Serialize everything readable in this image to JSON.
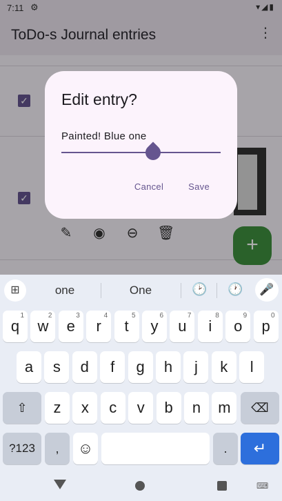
{
  "status_bar": {
    "time": "7:11",
    "gear_icon": "⚙",
    "system_icons": "▾◢▮"
  },
  "app_bar": {
    "title": "ToDo-s Journal entries",
    "menu_icon": "⋮"
  },
  "list": {
    "row1_checked": "✓",
    "row2_checked": "✓",
    "actions": [
      "✎",
      "◉",
      "⊖",
      "🗑"
    ],
    "fab_icon": "+"
  },
  "dialog": {
    "title": "Edit entry?",
    "field_value": "Painted! Blue one",
    "cancel_label": "Cancel",
    "save_label": "Save"
  },
  "keyboard": {
    "suggestions": [
      "one",
      "One"
    ],
    "grid_icon": "⊞",
    "mic_icon": "🎤",
    "emoji1": "🕑",
    "emoji2": "🕐",
    "row1": [
      {
        "k": "q",
        "h": "1"
      },
      {
        "k": "w",
        "h": "2"
      },
      {
        "k": "e",
        "h": "3"
      },
      {
        "k": "r",
        "h": "4"
      },
      {
        "k": "t",
        "h": "5"
      },
      {
        "k": "y",
        "h": "6"
      },
      {
        "k": "u",
        "h": "7"
      },
      {
        "k": "i",
        "h": "8"
      },
      {
        "k": "o",
        "h": "9"
      },
      {
        "k": "p",
        "h": "0"
      }
    ],
    "row2": [
      "a",
      "s",
      "d",
      "f",
      "g",
      "h",
      "j",
      "k",
      "l"
    ],
    "row3": [
      "z",
      "x",
      "c",
      "v",
      "b",
      "n",
      "m"
    ],
    "shift_icon": "⇧",
    "backspace_icon": "⌫",
    "sym_label": "?123",
    "comma": ",",
    "emoji_key": "☺",
    "period": ".",
    "enter_icon": "↵"
  },
  "nav": {
    "keyboard_icon": "⌨"
  }
}
